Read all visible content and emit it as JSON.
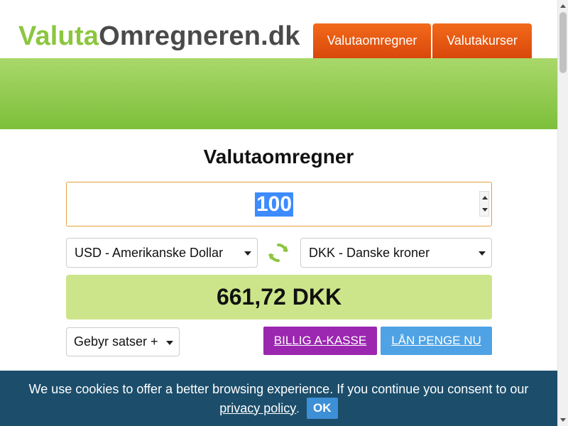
{
  "header": {
    "logo_part1": "Valuta",
    "logo_part2": "Omregneren.dk",
    "nav": [
      {
        "label": "Valutaomregner"
      },
      {
        "label": "Valutakurser"
      }
    ]
  },
  "main": {
    "title": "Valutaomregner",
    "amount": "100",
    "from_currency": "USD - Amerikanske Dollar",
    "to_currency": "DKK - Danske kroner",
    "result": "661,72 DKK",
    "fee_select": "Gebyr satser +",
    "buttons": {
      "kasse": "BILLIG A-KASSE",
      "laan": "LÅN PENGE NU"
    }
  },
  "cookie": {
    "text": "We use cookies to offer a better browsing experience. If you continue you consent to our",
    "link": "privacy policy",
    "suffix": ".",
    "ok": "OK"
  },
  "colors": {
    "logo_green": "#8cc63f",
    "logo_gray": "#4a4a4a",
    "nav_orange": "#e8561a",
    "banner_green": "#8cc94a",
    "result_bg": "#cde58a",
    "kasse_btn": "#9b27b0",
    "laan_btn": "#4fa3e4",
    "cookie_bg": "#1c4e6b",
    "ok_btn": "#3d8fd6"
  },
  "icons": {
    "swap": "refresh-arrows-icon",
    "dropdown": "chevron-down-icon"
  }
}
